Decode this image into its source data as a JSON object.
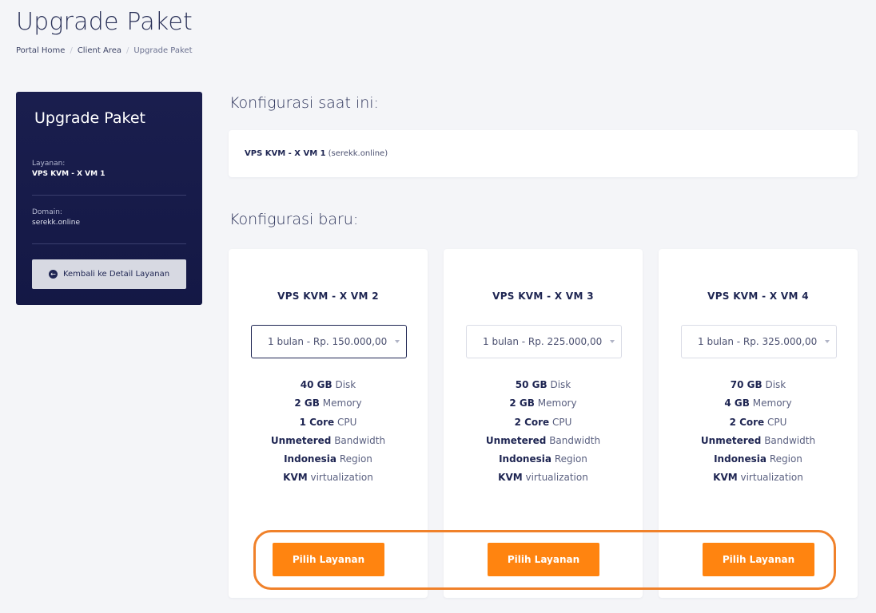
{
  "page": {
    "title": "Upgrade Paket",
    "breadcrumb": [
      "Portal Home",
      "Client Area",
      "Upgrade Paket"
    ]
  },
  "sidebar": {
    "title": "Upgrade Paket",
    "service_label": "Layanan:",
    "service_value": "VPS KVM - X VM 1",
    "domain_label": "Domain:",
    "domain_value": "serekk.online",
    "back_button": "Kembali ke Detail Layanan",
    "back_icon": "arrow-circle-left-icon"
  },
  "current_config": {
    "heading": "Konfigurasi saat ini:",
    "product": "VPS KVM - X VM 1",
    "domain": "(serekk.online)"
  },
  "new_config": {
    "heading": "Konfigurasi baru:",
    "plans": [
      {
        "name": "VPS KVM - X VM 2",
        "cycle": "1 bulan - Rp. 150.000,00",
        "features": [
          {
            "value": "40 GB",
            "label": "Disk"
          },
          {
            "value": "2 GB",
            "label": "Memory"
          },
          {
            "value": "1 Core",
            "label": "CPU"
          },
          {
            "value": "Unmetered",
            "label": "Bandwidth"
          },
          {
            "value": "Indonesia",
            "label": "Region"
          },
          {
            "value": "KVM",
            "label": "virtualization"
          }
        ],
        "button": "Pilih Layanan"
      },
      {
        "name": "VPS KVM - X VM 3",
        "cycle": "1 bulan - Rp. 225.000,00",
        "features": [
          {
            "value": "50 GB",
            "label": "Disk"
          },
          {
            "value": "2 GB",
            "label": "Memory"
          },
          {
            "value": "2 Core",
            "label": "CPU"
          },
          {
            "value": "Unmetered",
            "label": "Bandwidth"
          },
          {
            "value": "Indonesia",
            "label": "Region"
          },
          {
            "value": "KVM",
            "label": "virtualization"
          }
        ],
        "button": "Pilih Layanan"
      },
      {
        "name": "VPS KVM - X VM 4",
        "cycle": "1 bulan - Rp. 325.000,00",
        "features": [
          {
            "value": "70 GB",
            "label": "Disk"
          },
          {
            "value": "4 GB",
            "label": "Memory"
          },
          {
            "value": "2 Core",
            "label": "CPU"
          },
          {
            "value": "Unmetered",
            "label": "Bandwidth"
          },
          {
            "value": "Indonesia",
            "label": "Region"
          },
          {
            "value": "KVM",
            "label": "virtualization"
          }
        ],
        "button": "Pilih Layanan"
      }
    ]
  },
  "colors": {
    "accent": "#ff8410",
    "sidebar_bg": "#161a4a",
    "highlight_ring": "#f0812a",
    "page_bg": "#f4f5f8"
  }
}
